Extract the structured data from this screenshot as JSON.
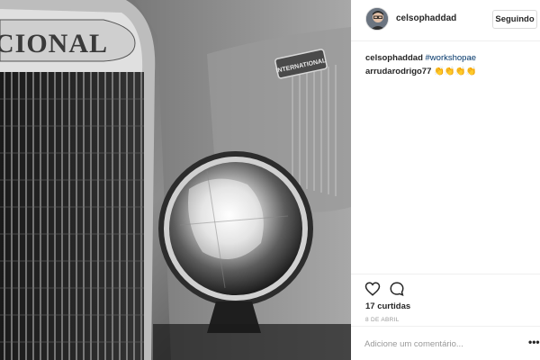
{
  "post": {
    "image_alt": "Black and white photo of a vintage car headlight and grille",
    "grille_text": "CIONAL",
    "badge_text": "INTERNATIONAL"
  },
  "header": {
    "username": "celsophaddad",
    "follow_label": "Seguindo"
  },
  "comments": [
    {
      "author": "celsophaddad",
      "text": "#workshopae"
    },
    {
      "author": "arrudarodrigo77",
      "text": "👏👏👏👏"
    }
  ],
  "actions": {
    "likes": "17 curtidas",
    "date": "8 DE ABRIL"
  },
  "add_comment": {
    "placeholder": "Adicione um comentário...",
    "more_icon": "more-options-icon"
  },
  "colors": {
    "hashtag": "#003569",
    "text": "#262626",
    "muted": "#999999",
    "border": "#efefef"
  }
}
